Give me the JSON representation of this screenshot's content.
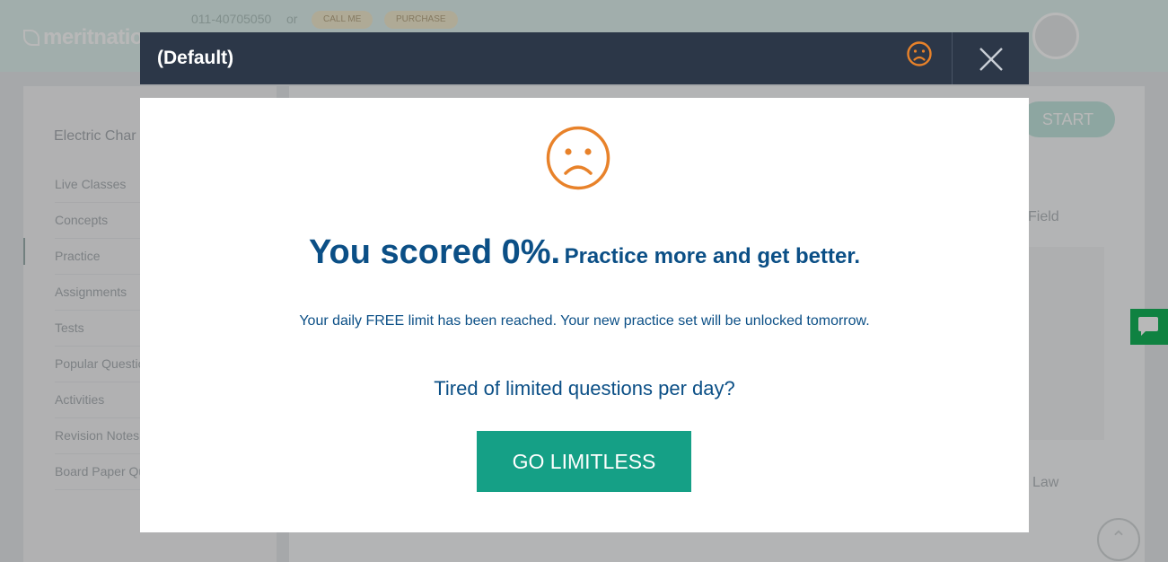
{
  "background": {
    "logo_text": "meritnation",
    "phone": "011-40705050",
    "or_text": "or",
    "call_me_label": "CALL ME",
    "purchase_label": "PURCHASE",
    "sidebar_title": "Electric Char",
    "sidebar_items": [
      {
        "label": "Live Classes"
      },
      {
        "label": "Concepts"
      },
      {
        "label": "Practice"
      },
      {
        "label": "Assignments"
      },
      {
        "label": "Tests"
      },
      {
        "label": "Popular Questio"
      },
      {
        "label": "Activities"
      },
      {
        "label": "Revision Notes"
      },
      {
        "label": "Board Paper Qu"
      }
    ],
    "start_label": "START",
    "field_text": "Field",
    "law_text": "Law",
    "scroll_up_icon": "chevron-up-icon",
    "chat_icon": "chat-bubble-icon"
  },
  "modal": {
    "title": "(Default)",
    "header_icon": "sad-face-icon",
    "close_icon": "close-icon",
    "result_icon": "sad-face-icon",
    "score_main": "You scored 0%.",
    "score_sub": "Practice more and get better.",
    "limit_text": "Your daily FREE limit has been reached. Your new practice set will be unlocked tomorrow.",
    "tired_text": "Tired of limited questions per day?",
    "cta_label": "GO LIMITLESS"
  },
  "colors": {
    "header_bg": "#2c3748",
    "accent_orange": "#e8822a",
    "text_blue": "#0b4f86",
    "cta_green": "#15a086",
    "chat_green": "#16b45a"
  }
}
